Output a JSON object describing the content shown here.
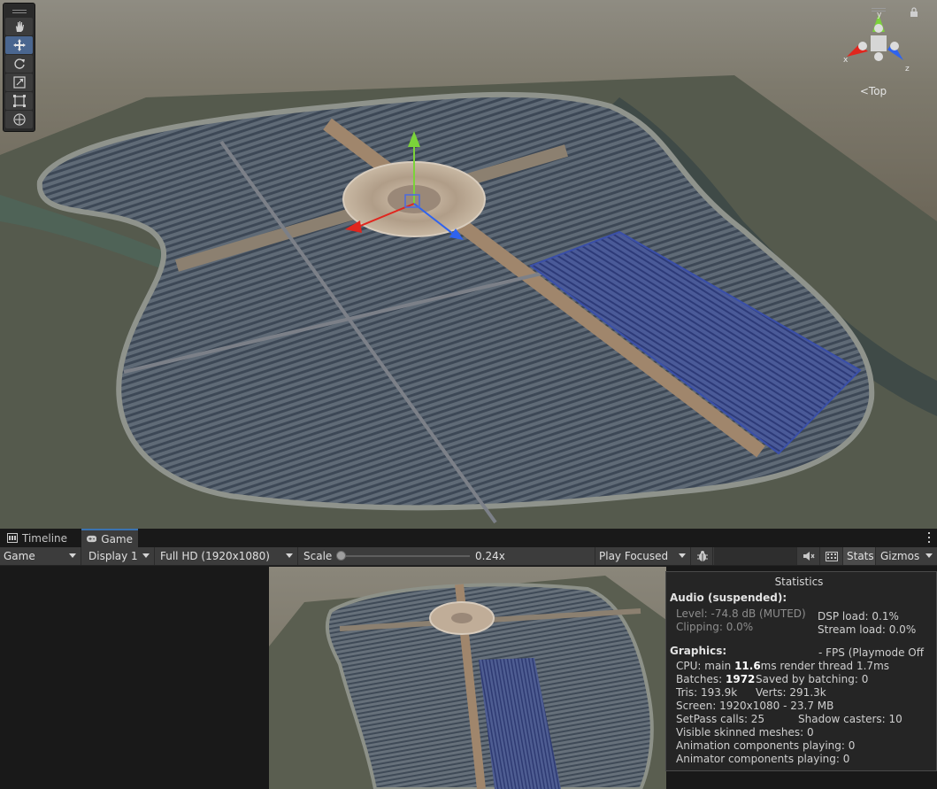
{
  "scene": {
    "view_label": "Top",
    "axis_labels": {
      "x": "x",
      "y": "y",
      "z": "z"
    },
    "tools": [
      "hand-tool",
      "move-tool",
      "rotate-tool",
      "scale-tool",
      "rect-tool",
      "transform-tool"
    ],
    "active_tool": "move-tool"
  },
  "tabs": [
    {
      "label": "Timeline",
      "icon": "timeline-icon"
    },
    {
      "label": "Game",
      "icon": "gamepad-icon"
    }
  ],
  "toolbar": {
    "game": "Game",
    "display": "Display 1",
    "resolution": "Full HD (1920x1080)",
    "scale_label": "Scale",
    "scale_value": "0.24x",
    "play_mode": "Play Focused",
    "stats": "Stats",
    "gizmos": "Gizmos"
  },
  "stats": {
    "title": "Statistics",
    "audio_head": "Audio (suspended):",
    "level": "Level: -74.8 dB (MUTED)",
    "clipping": "Clipping: 0.0%",
    "dsp": "DSP load: 0.1%",
    "stream": "Stream load: 0.0%",
    "graphics_head": "Graphics:",
    "fps": "- FPS (Playmode Off",
    "cpu_prefix": "CPU: main ",
    "cpu_main": "11.6",
    "cpu_suffix": "ms  render thread 1.7ms",
    "batches_prefix": "Batches: ",
    "batches": "1972",
    "saved_batching": "Saved by batching: 0",
    "tris": "Tris: 193.9k",
    "verts": "Verts: 291.3k",
    "screen": "Screen: 1920x1080 - 23.7 MB",
    "setpass": "SetPass calls: 25",
    "shadow": "Shadow casters: 10",
    "skinned": "Visible skinned meshes: 0",
    "anim": "Animation components playing: 0",
    "animator": "Animator components playing: 0"
  },
  "colors": {
    "editor_bg": "#191919",
    "toolbar_bg": "#3c3c3c",
    "active_tool": "#4a668f",
    "axis_x": "#e0261e",
    "axis_y": "#7bd33a",
    "axis_z": "#2f63ee"
  }
}
